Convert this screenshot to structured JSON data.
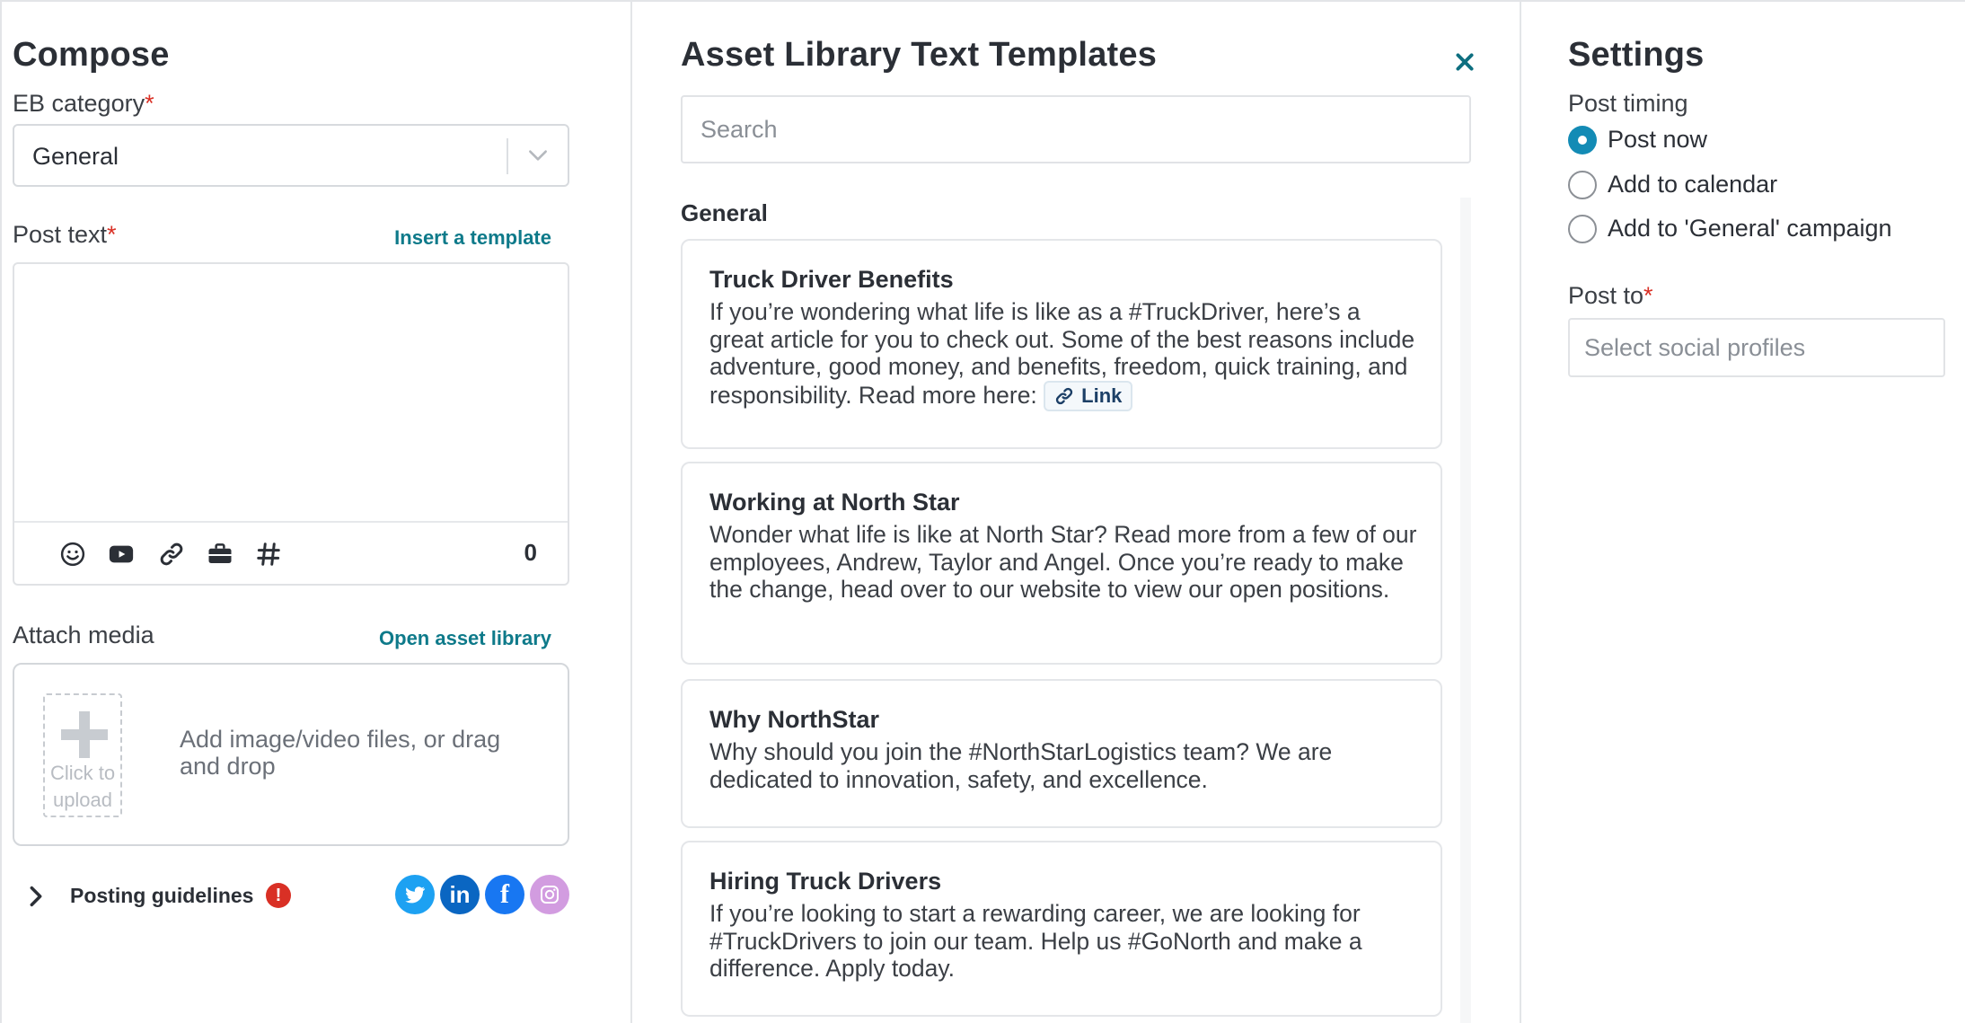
{
  "compose": {
    "title": "Compose",
    "category_label": "EB category",
    "required_mark": "*",
    "category_value": "General",
    "post_text_label": "Post text",
    "insert_template_link": "Insert a template",
    "char_count": "0",
    "toolbar_icons": [
      "emoji-icon",
      "youtube-icon",
      "link-icon",
      "briefcase-icon",
      "hashtag-icon"
    ],
    "attach_media_label": "Attach media",
    "open_asset_library_link": "Open asset library",
    "upload_text": "Click to upload",
    "drop_text": "Add image/video files, or drag and drop",
    "posting_guidelines": "Posting guidelines",
    "guidelines_warning": "!",
    "social_networks": [
      {
        "name": "twitter-icon",
        "color": "#1da1f2"
      },
      {
        "name": "linkedin-icon",
        "color": "#0a66c2"
      },
      {
        "name": "facebook-icon",
        "color": "#1877f2"
      },
      {
        "name": "instagram-icon",
        "color": "#d29ce0"
      }
    ]
  },
  "library": {
    "title": "Asset Library Text Templates",
    "search_placeholder": "Search",
    "section": "General",
    "cards": [
      {
        "title": "Truck Driver Benefits",
        "body": "If you’re wondering what life is like as a #TruckDriver, here’s a great article for you to check out. Some of the best reasons include adventure, good money, and benefits, freedom, quick training, and responsibility. Read more here:",
        "chip": "Link"
      },
      {
        "title": "Working at North Star",
        "body": "Wonder what life is like at North Star? Read more from a few of our employees, Andrew, Taylor and Angel. Once you’re ready to make the change, head over to our website to view our open positions."
      },
      {
        "title": "Why NorthStar",
        "body": "Why should you join the #NorthStarLogistics team? We are dedicated to innovation, safety, and excellence."
      },
      {
        "title": "Hiring Truck Drivers",
        "body": "If you’re looking to start a rewarding career, we are looking for #TruckDrivers to join our team. Help us #GoNorth and make a difference. Apply today."
      }
    ]
  },
  "settings": {
    "title": "Settings",
    "post_timing_label": "Post timing",
    "options": [
      "Post now",
      "Add to calendar",
      "Add to 'General' campaign"
    ],
    "selected_option": "Post now",
    "post_to_label": "Post to",
    "post_to_placeholder": "Select social profiles"
  },
  "colors": {
    "accent_teal": "#0e7a8a",
    "radio_selected": "#138bb5",
    "required": "#d93025"
  }
}
